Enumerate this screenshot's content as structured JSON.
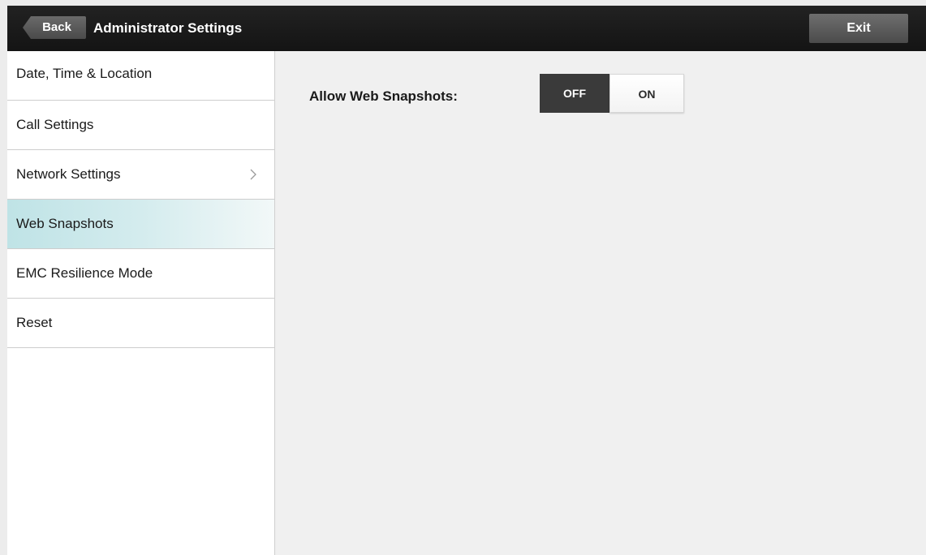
{
  "header": {
    "back_label": "Back",
    "title": "Administrator Settings",
    "exit_label": "Exit"
  },
  "sidebar": {
    "items": [
      {
        "label": "Date, Time & Location"
      },
      {
        "label": "Call Settings"
      },
      {
        "label": "Network Settings",
        "has_chevron": true
      },
      {
        "label": "Web Snapshots",
        "selected": true
      },
      {
        "label": "EMC Resilience Mode"
      },
      {
        "label": "Reset"
      }
    ]
  },
  "main": {
    "setting_label": "Allow Web Snapshots:",
    "toggle": {
      "off_label": "OFF",
      "on_label": "ON",
      "value": "OFF"
    }
  },
  "colors": {
    "header_bg": "#1b1b1b",
    "selected_item": "#bfe3e6",
    "toggle_active": "#3a3a3a",
    "content_bg": "#f0f0f0"
  }
}
